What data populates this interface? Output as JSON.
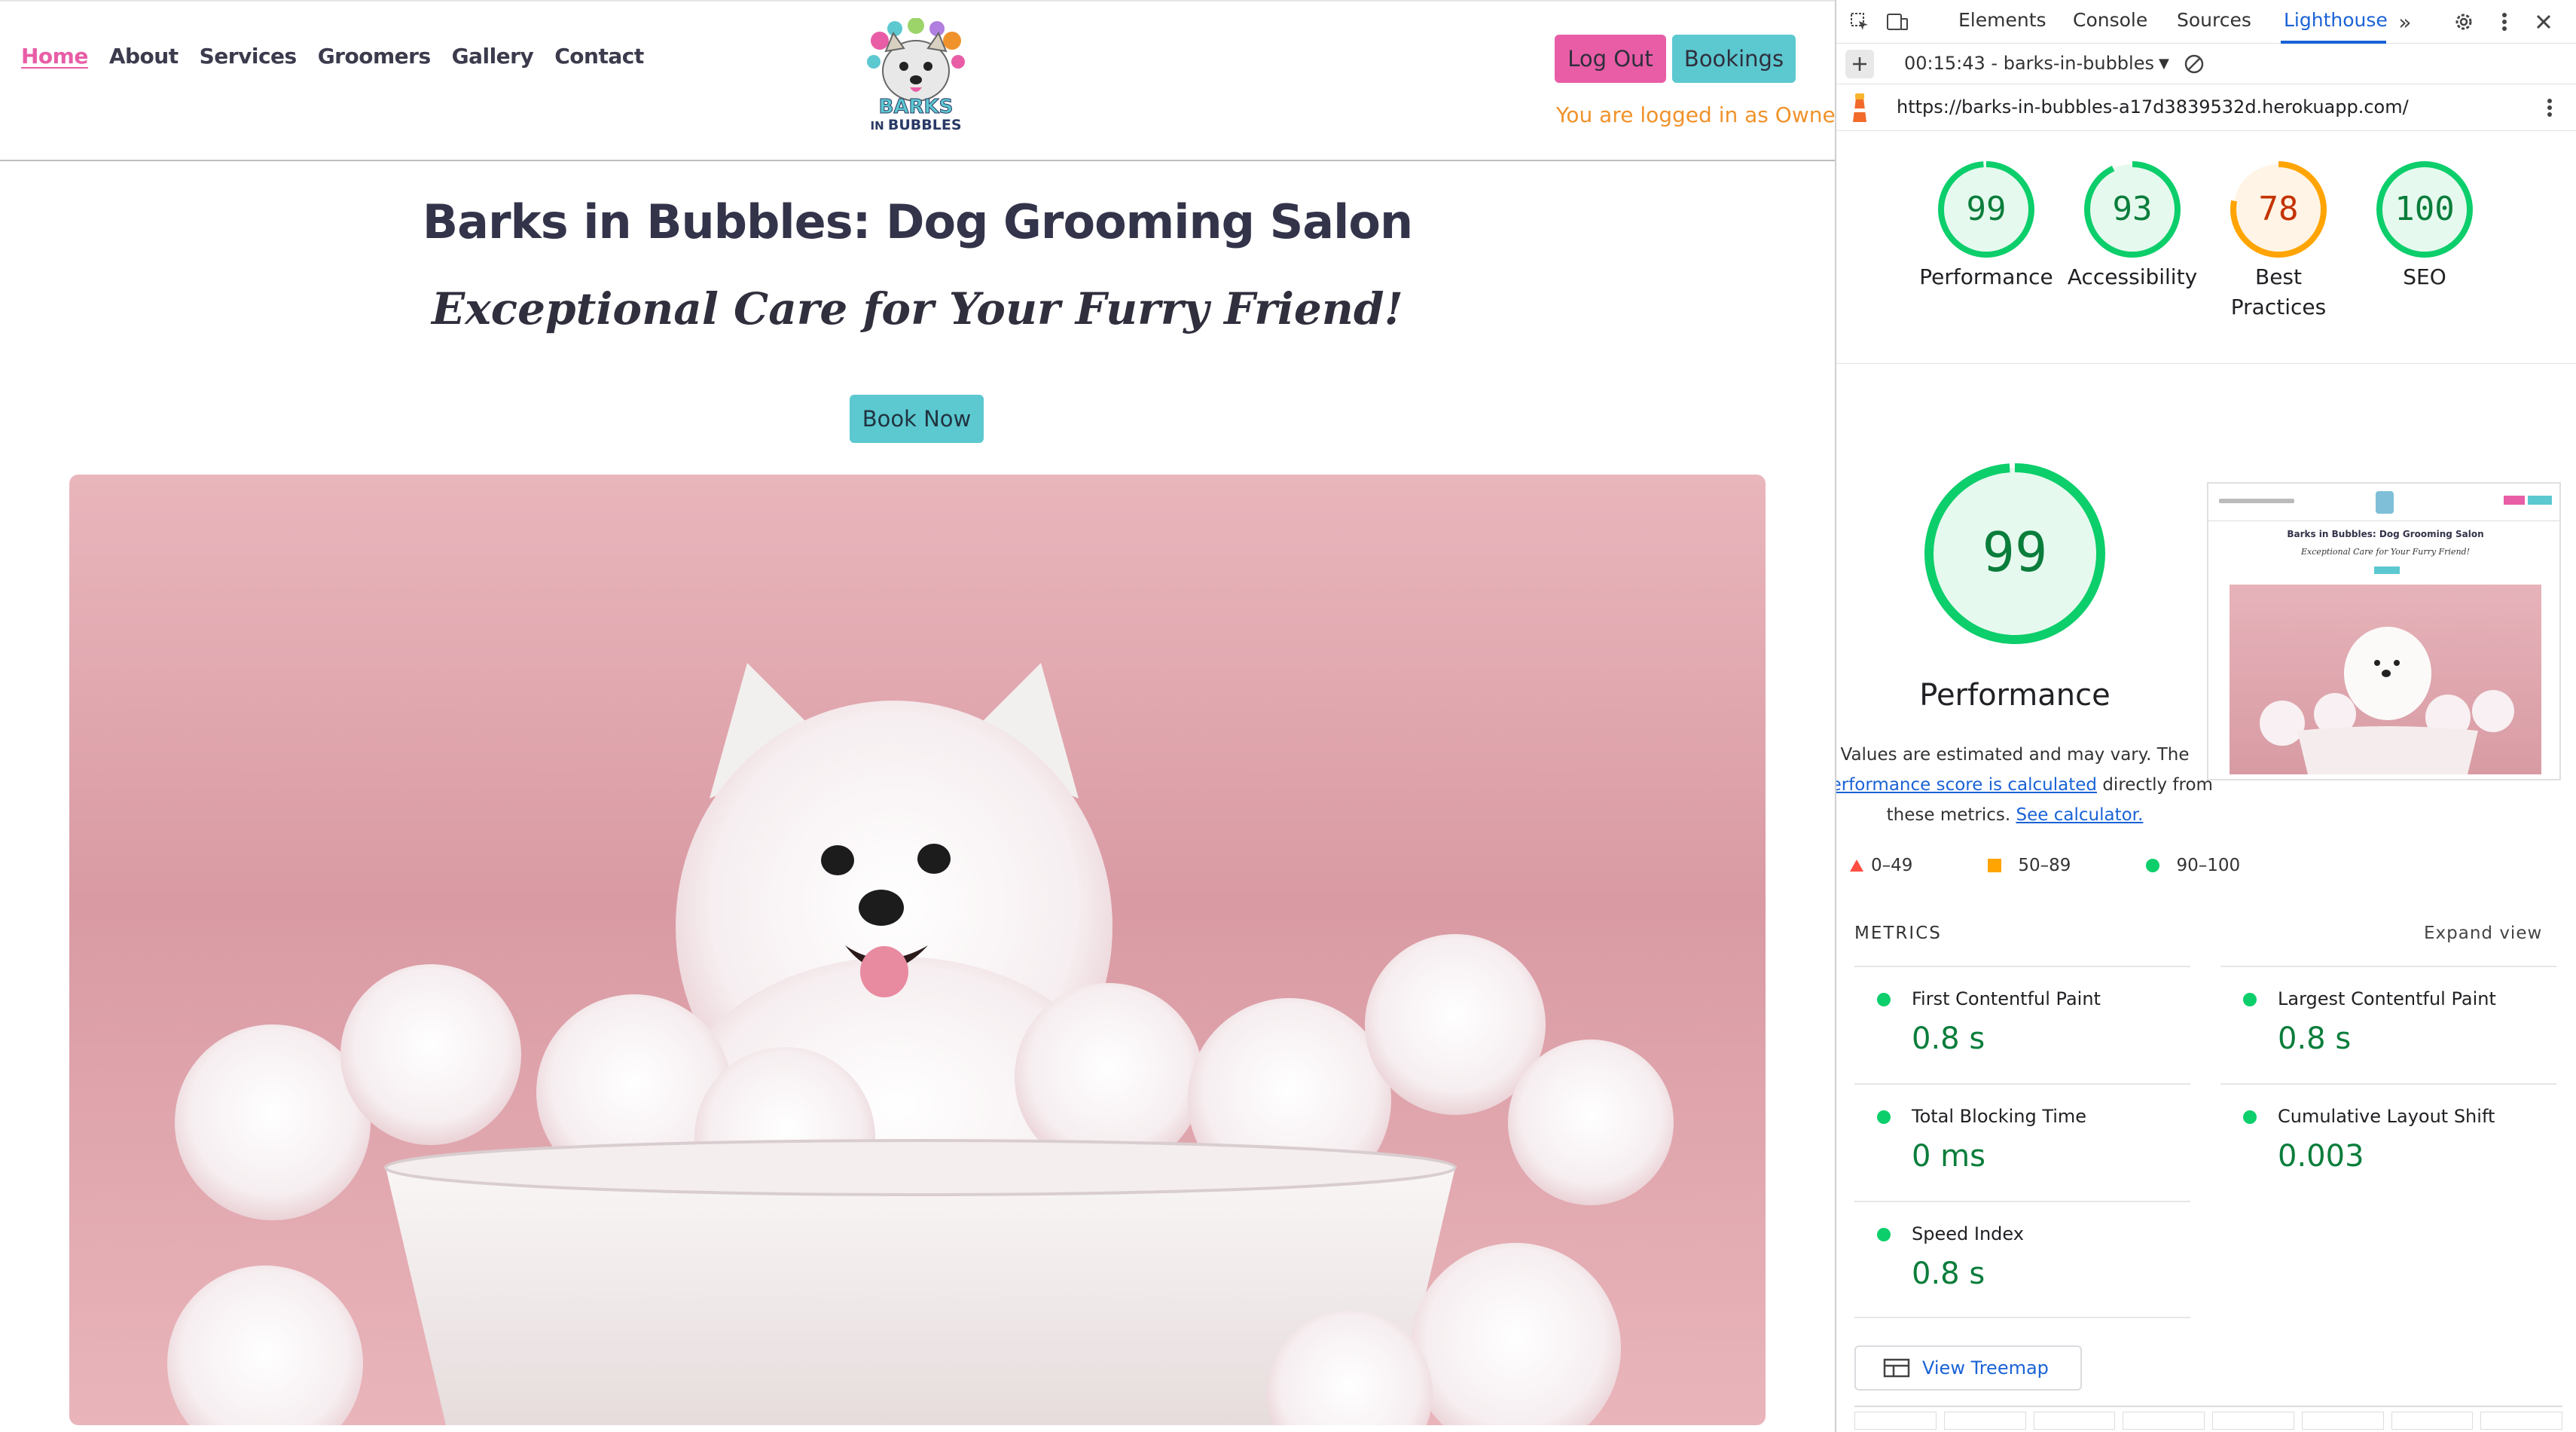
{
  "site": {
    "nav": [
      "Home",
      "About",
      "Services",
      "Groomers",
      "Gallery",
      "Contact"
    ],
    "logo_text_top": "BARKS",
    "logo_text_mid": "IN",
    "logo_text_bottom": "BUBBLES",
    "logout_label": "Log Out",
    "bookings_label": "Bookings",
    "logged_in_text": "You are logged in as Owner",
    "title": "Barks in Bubbles: Dog Grooming Salon",
    "subtitle": "Exceptional Care for Your Furry Friend!",
    "book_now_label": "Book Now",
    "colors": {
      "pink": "#e85da6",
      "teal": "#5cc8d0",
      "orange": "#f0922b",
      "heading": "#33334a"
    }
  },
  "devtools": {
    "tabs": [
      "Elements",
      "Console",
      "Sources",
      "Lighthouse"
    ],
    "active_tab": "Lighthouse",
    "report_selector": "00:15:43 - barks-in-bubbles",
    "url": "https://barks-in-bubbles-a17d3839532d.herokuapp.com/",
    "scores": [
      {
        "label": "Performance",
        "value": 99,
        "color": "#0cce6b"
      },
      {
        "label": "Accessibility",
        "value": 93,
        "color": "#0cce6b"
      },
      {
        "label_line1": "Best",
        "label_line2": "Practices",
        "value": 78,
        "color": "#ffa400"
      },
      {
        "label": "SEO",
        "value": 100,
        "color": "#0cce6b"
      }
    ],
    "perf": {
      "score": 99,
      "title": "Performance",
      "note_1": "Values are estimated and may vary. The",
      "note_link": "performance score is calculated",
      "note_2": "directly from",
      "note_3": "these metrics.",
      "note_link2": "See calculator."
    },
    "legend": [
      "0–49",
      "50–89",
      "90–100"
    ],
    "metrics_header": "METRICS",
    "expand_view": "Expand view",
    "metrics": [
      {
        "label": "First Contentful Paint",
        "value": "0.8 s"
      },
      {
        "label": "Largest Contentful Paint",
        "value": "0.8 s"
      },
      {
        "label": "Total Blocking Time",
        "value": "0 ms"
      },
      {
        "label": "Cumulative Layout Shift",
        "value": "0.003"
      },
      {
        "label": "Speed Index",
        "value": "0.8 s"
      }
    ],
    "treemap_label": "View Treemap",
    "thumb": {
      "title": "Barks in Bubbles: Dog Grooming Salon",
      "subtitle": "Exceptional Care for Your Furry Friend!"
    }
  }
}
